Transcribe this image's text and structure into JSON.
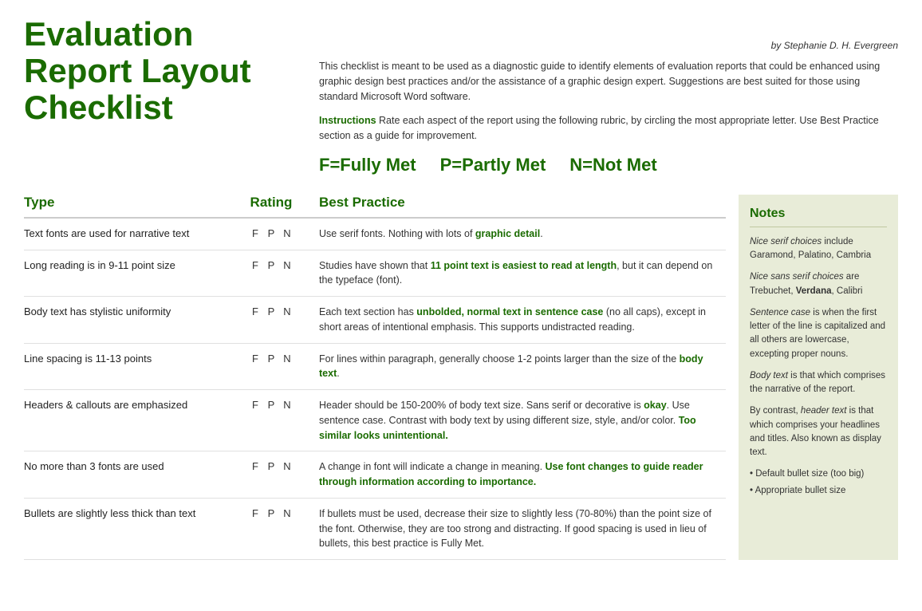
{
  "byline": "by Stephanie D. H. Evergreen",
  "title": {
    "line1": "Evaluation",
    "line2": "Report Layout",
    "line3": "Checklist"
  },
  "intro": {
    "body": "This checklist is meant to be used as a diagnostic guide to identify elements of evaluation reports that could be enhanced using graphic design best practices and/or the assistance of a graphic design expert. Suggestions are best suited for those using standard Microsoft Word software.",
    "instructions_label": "Instructions",
    "instructions_body": "Rate each aspect of the report using the following rubric, by circling the most appropriate letter. Use Best Practice section as a guide for improvement."
  },
  "legend": {
    "f": "F=Fully Met",
    "p": "P=Partly Met",
    "n": "N=Not Met"
  },
  "columns": {
    "type": "Type",
    "rating": "Rating",
    "practice": "Best Practice"
  },
  "rows": [
    {
      "type": "Text fonts are used for narrative text",
      "practice": "Use serif fonts. Nothing with lots of graphic detail."
    },
    {
      "type": "Long reading is in 9-11 point size",
      "practice": "Studies have shown that 11 point text is easiest to read at length, but it can depend on the typeface (font)."
    },
    {
      "type": "Body text has stylistic uniformity",
      "practice": "Each text section has unbolded, normal text in sentence case (no all caps), except in short areas of intentional emphasis. This supports undistracted reading."
    },
    {
      "type": "Line spacing is 11-13 points",
      "practice": "For lines within paragraph, generally choose 1-2 points larger than the size of the body text."
    },
    {
      "type": "Headers & callouts are emphasized",
      "practice": "Header should be 150-200% of body text size. Sans serif or decorative is okay. Use sentence case. Contrast with body text by using different size, style, and/or color. Too similar looks unintentional."
    },
    {
      "type": "No more than 3 fonts are used",
      "practice": "A change in font will indicate a change in meaning. Use font changes to guide reader through information according to importance."
    },
    {
      "type": "Bullets are slightly less thick than text",
      "practice": "If bullets must be used, decrease their size to slightly less (70-80%) than the point size of the font. Otherwise, they are too strong and distracting. If good spacing is used in lieu of bullets, this best practice is Fully Met."
    }
  ],
  "notes": {
    "header": "Notes",
    "items": [
      {
        "id": "serif",
        "italic_part": "Nice serif choices",
        "normal_part": " include Garamond, Palatino, Cambria"
      },
      {
        "id": "sans-serif",
        "italic_part": "Nice sans serif choices",
        "normal_part": " are Trebuchet, Verdana, Calibri"
      },
      {
        "id": "sentence-case",
        "italic_part": "Sentence case",
        "normal_part": " is when the first letter of the line is capitalized and all others are lowercase, excepting proper nouns."
      },
      {
        "id": "body-text",
        "italic_part": "Body text",
        "normal_part": " is that which comprises the narrative of the report."
      },
      {
        "id": "header-text",
        "normal_intro": "By contrast, ",
        "italic_part": "header text",
        "normal_part": " is that which comprises your headlines and titles. Also known as display text."
      }
    ],
    "bullets": [
      "Default bullet size (too big)",
      "Appropriate bullet size"
    ]
  }
}
